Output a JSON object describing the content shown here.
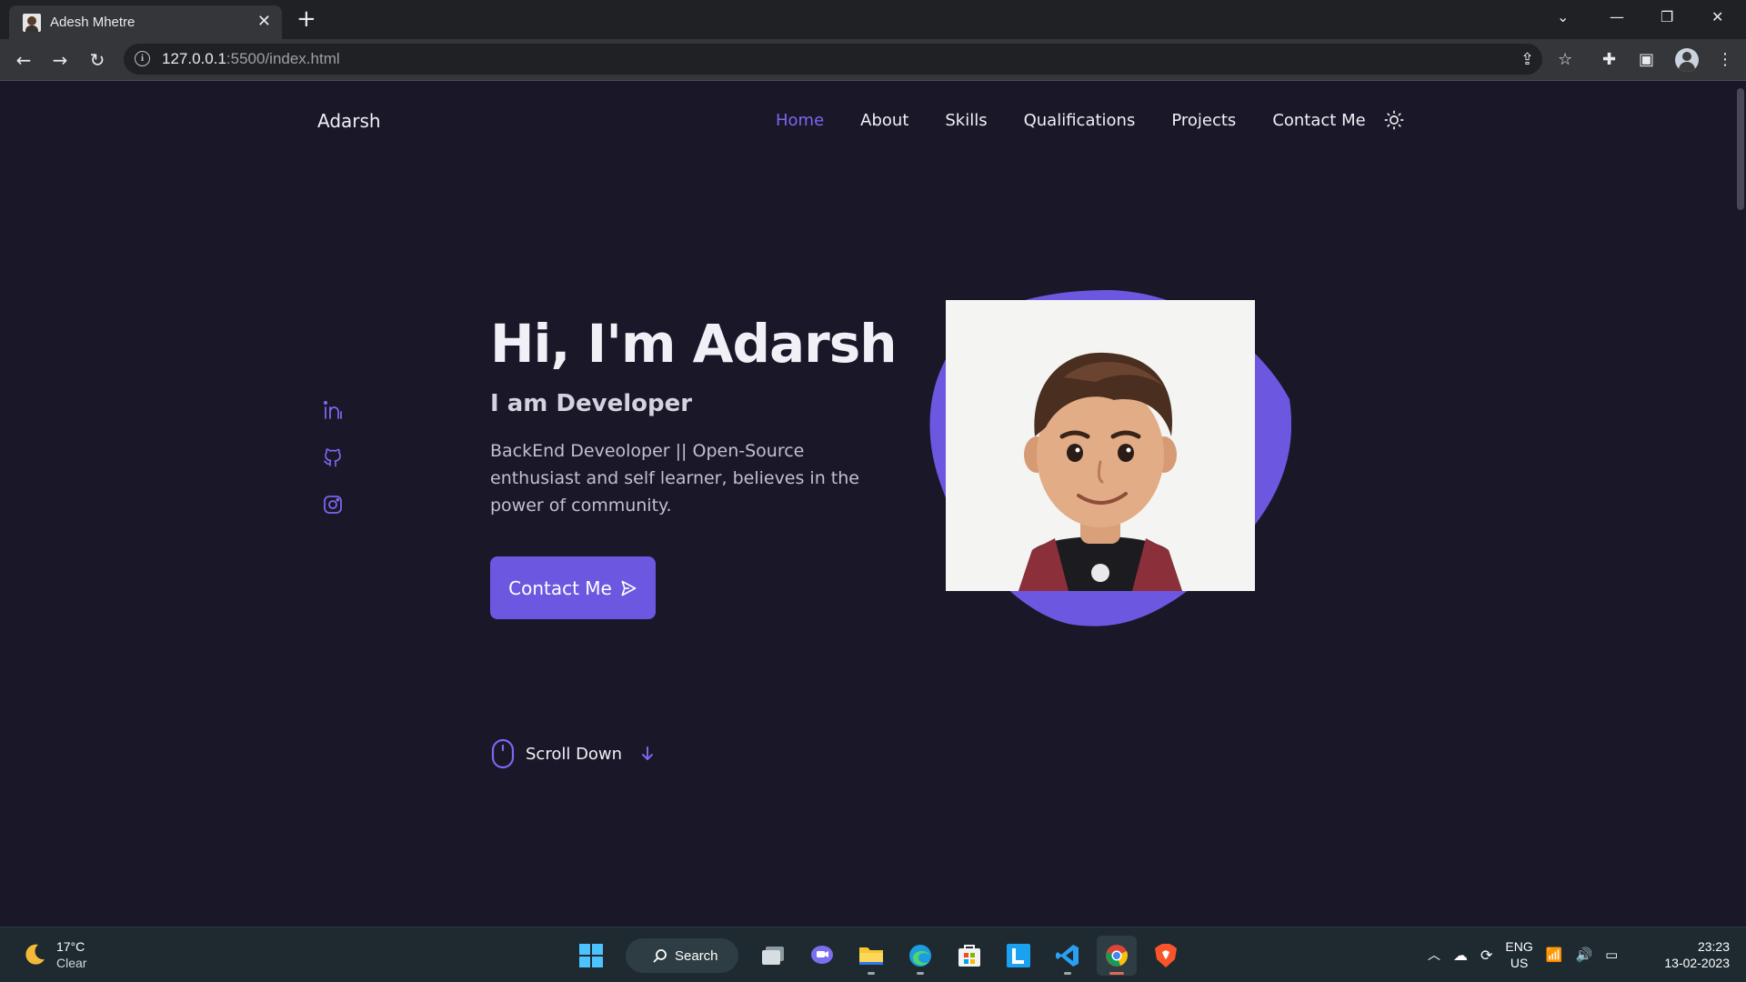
{
  "browser": {
    "tab_title": "Adesh Mhetre",
    "url_host": "127.0.0.1",
    "url_rest": ":5500/index.html"
  },
  "site": {
    "brand": "Adarsh",
    "nav": [
      "Home",
      "About",
      "Skills",
      "Qualifications",
      "Projects",
      "Contact Me"
    ],
    "active_nav": "Home",
    "accent_color": "#6c58e0",
    "background_color": "#1a1728"
  },
  "hero": {
    "title": "Hi, I'm Adarsh",
    "subtitle": "I am Developer",
    "description": "BackEnd Deveoloper || Open-Source enthusiast and self learner, believes in the power of community.",
    "cta_label": "Contact Me"
  },
  "socials": [
    "linkedin-icon",
    "github-icon",
    "instagram-icon"
  ],
  "scroll": {
    "label": "Scroll Down"
  },
  "taskbar": {
    "weather_temp": "17°C",
    "weather_cond": "Clear",
    "search_label": "Search",
    "lang_top": "ENG",
    "lang_bottom": "US",
    "time": "23:23",
    "date": "13-02-2023"
  }
}
